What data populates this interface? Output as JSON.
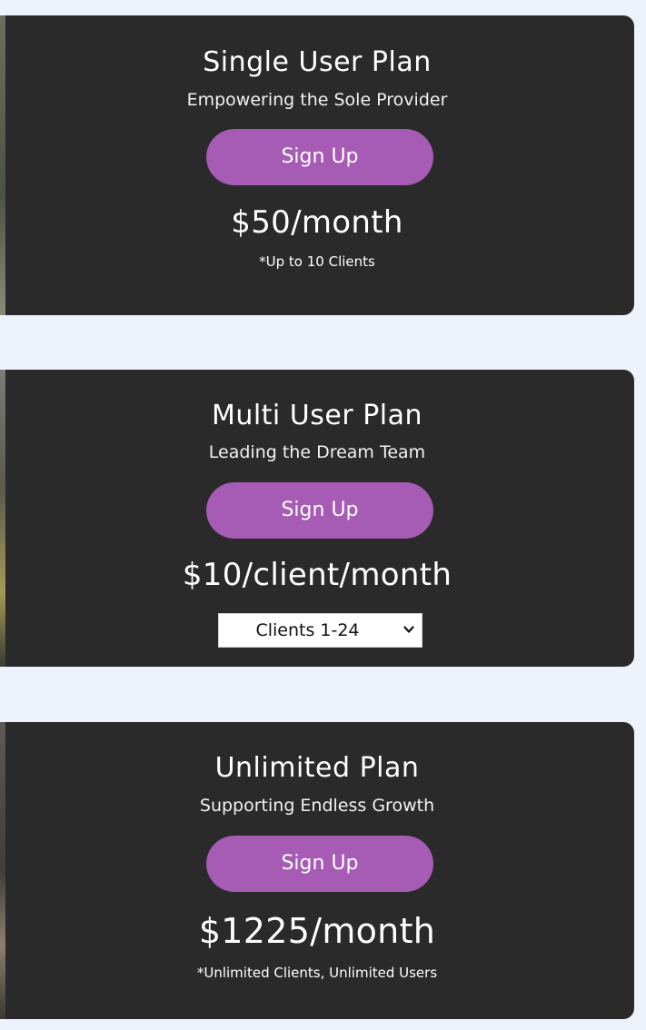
{
  "plans": [
    {
      "title": "Single User Plan",
      "tagline": "Empowering the Sole Provider",
      "button_label": "Sign Up",
      "price": "$50/month",
      "note": "*Up to 10 Clients"
    },
    {
      "title": "Multi User Plan",
      "tagline": "Leading the Dream Team",
      "button_label": "Sign Up",
      "price": "$10/client/month",
      "clients_select": {
        "selected": "Clients 1-24"
      }
    },
    {
      "title": "Unlimited Plan",
      "tagline": "Supporting Endless Growth",
      "button_label": "Sign Up",
      "price": "$1225/month",
      "note": "*Unlimited Clients, Unlimited Users"
    }
  ],
  "colors": {
    "page_background": "#eef2fa",
    "card_background": "#2a2a2a",
    "button_accent": "#a65bb5",
    "text": "#ffffff"
  },
  "icons": {
    "select_chevron": "chevron-down-icon"
  }
}
